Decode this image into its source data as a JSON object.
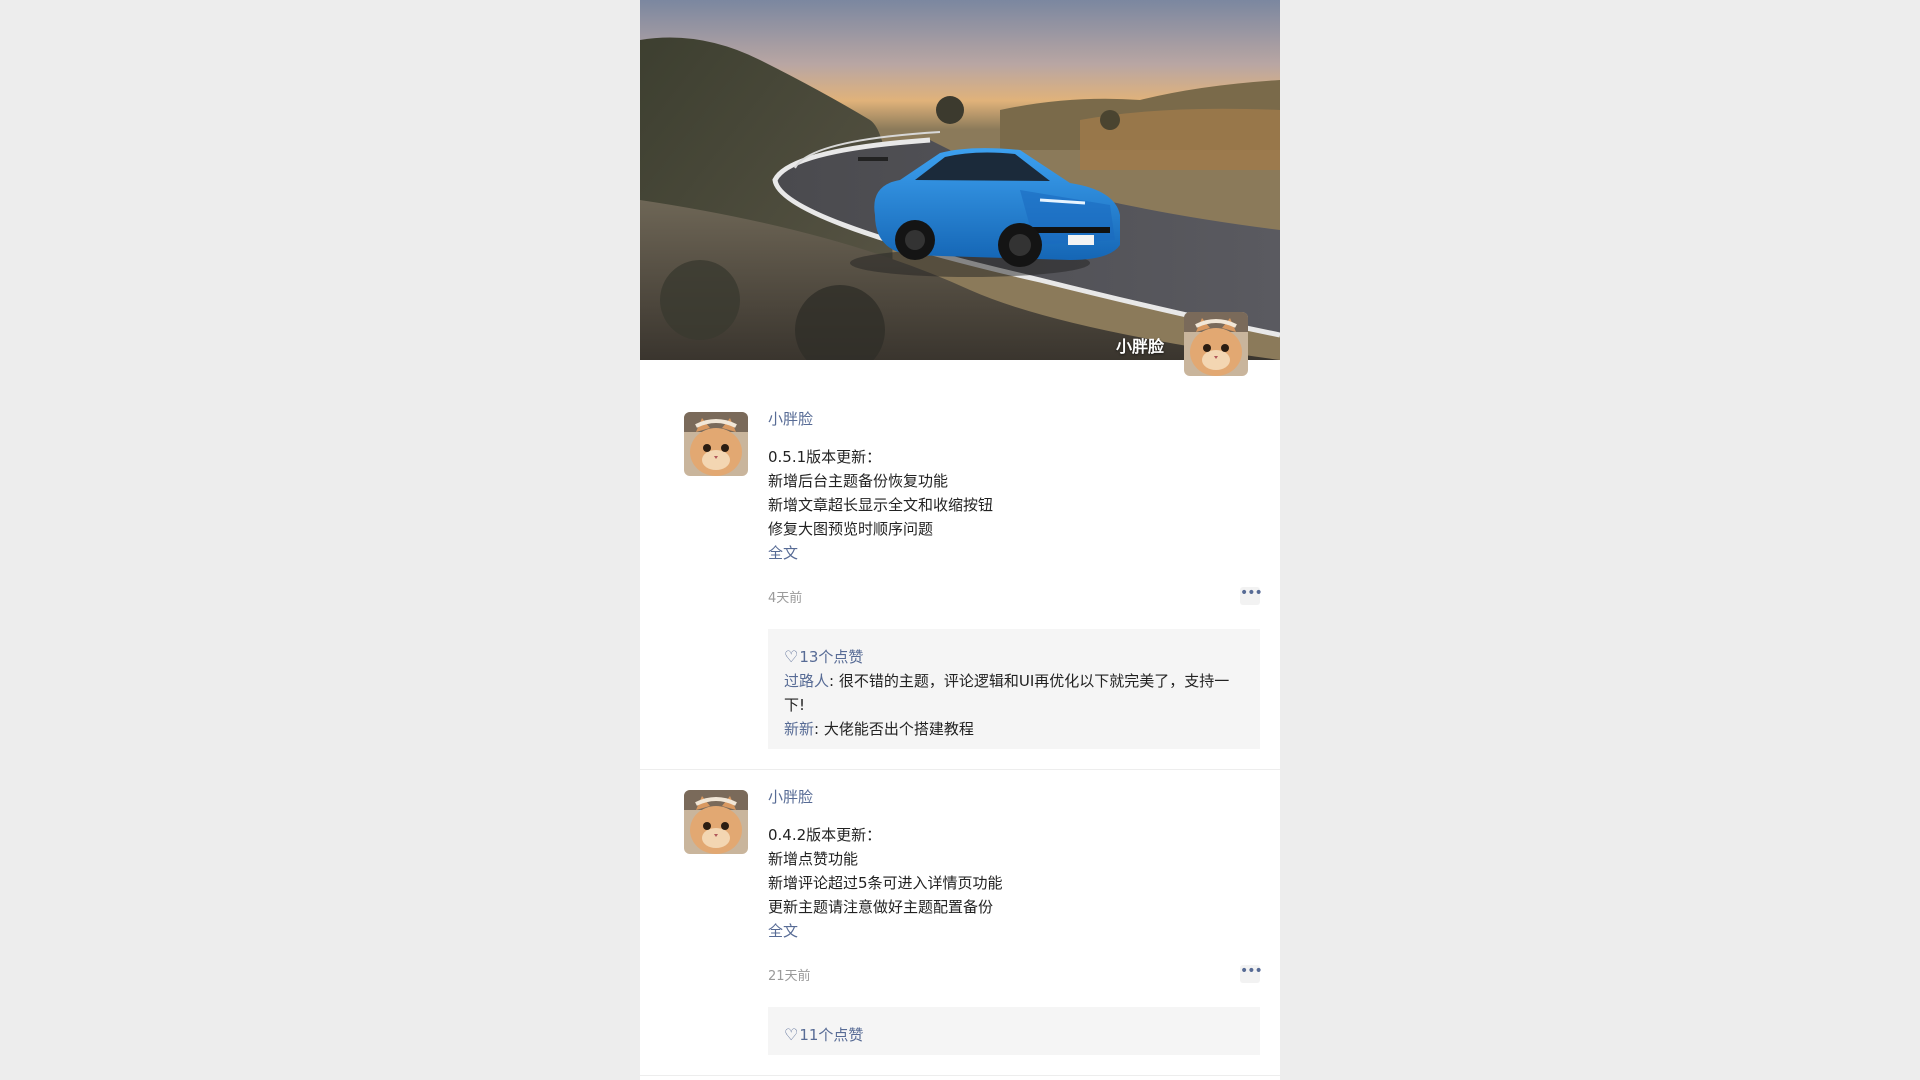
{
  "cover": {
    "name": "小胖脸"
  },
  "posts": [
    {
      "author": "小胖脸",
      "lines": [
        "0.5.1版本更新：",
        "新增后台主题备份恢复功能",
        "新增文章超长显示全文和收缩按钮",
        "修复大图预览时顺序问题"
      ],
      "fulltext": "全文",
      "time": "4天前",
      "likes": "13个点赞",
      "comments": [
        {
          "name": "过路人",
          "text": ": 很不错的主题，评论逻辑和UI再优化以下就完美了，支持一下!"
        },
        {
          "name": "新新",
          "text": ": 大佬能否出个搭建教程"
        }
      ]
    },
    {
      "author": "小胖脸",
      "lines": [
        "0.4.2版本更新：",
        "新增点赞功能",
        "新增评论超过5条可进入详情页功能",
        "更新主题请注意做好主题配置备份"
      ],
      "fulltext": "全文",
      "time": "21天前",
      "likes": "11个点赞",
      "comments": []
    }
  ],
  "colors": {
    "link": "#576b95",
    "text": "#222222",
    "time": "#9a9a9a",
    "panel": "#f5f5f5",
    "page_bg": "#ededed"
  },
  "icons": {
    "heart": "heart-icon",
    "more": "more-dots-icon"
  }
}
